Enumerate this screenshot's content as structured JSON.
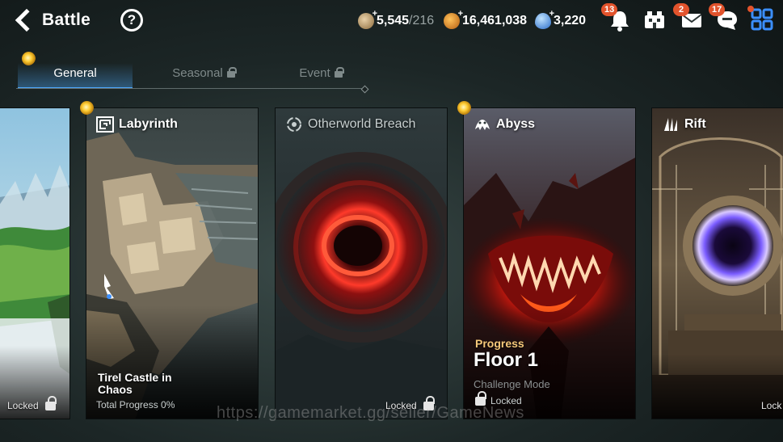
{
  "header": {
    "title": "Battle",
    "help_label": "?",
    "resources": [
      {
        "name": "stamina",
        "value": "5,545",
        "max": "/216"
      },
      {
        "name": "gold",
        "value": "16,461,038"
      },
      {
        "name": "skystone",
        "value": "3,220"
      }
    ],
    "notifications": {
      "alerts": "13",
      "mail": "2",
      "chat": "17"
    }
  },
  "tabs": [
    {
      "label": "General",
      "active": true
    },
    {
      "label": "Seasonal",
      "active": false,
      "locked": true
    },
    {
      "label": "Event",
      "active": false,
      "locked": true
    }
  ],
  "cards": [
    {
      "title": "",
      "status": "Locked"
    },
    {
      "title": "Labyrinth",
      "subtitle": "Tirel Castle in Chaos",
      "progress": "Total Progress 0%"
    },
    {
      "title": "Otherworld Breach",
      "status": "Locked"
    },
    {
      "title": "Abyss",
      "progress_label": "Progress",
      "floor": "Floor 1",
      "mode": "Challenge Mode",
      "status": "Locked"
    },
    {
      "title": "Rift",
      "status": "Lock"
    }
  ],
  "watermark": "https://gamemarket.gg/seller/GameNews",
  "colors": {
    "accent": "#4ea9ff",
    "badge": "#e2532c",
    "orb": "#ffcc33",
    "abyss_red": "#e0341c"
  }
}
